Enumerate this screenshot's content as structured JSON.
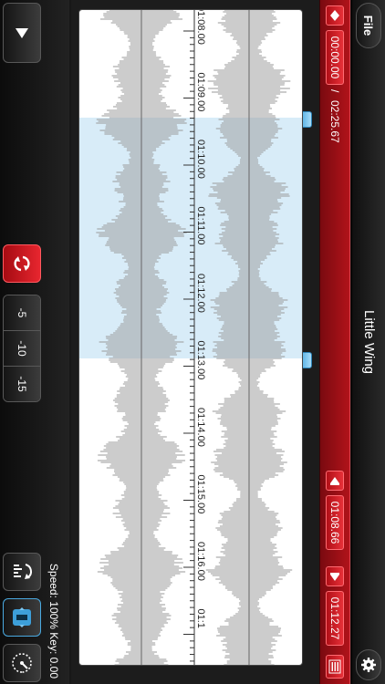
{
  "app": {
    "title": "Little Wing",
    "file_label": "File",
    "settings_icon": "gear-icon"
  },
  "transport": {
    "current_time": "00:00.00",
    "separator": "/",
    "total_time": "02:25.67",
    "loop_start": "01:08.66",
    "loop_end": "01:12.27",
    "icons": [
      "skip-to-start-icon",
      "prev-marker-icon",
      "next-marker-icon",
      "list-icon"
    ]
  },
  "waveform": {
    "time_labels": [
      "01:08.00",
      "01:09.00",
      "01:10.00",
      "01:11.00",
      "01:12.00",
      "01:13.00",
      "01:14.00",
      "01:15.00",
      "01:16.00",
      "01:1"
    ],
    "selection_color": "#a8d4f0",
    "wave_color": "#9a9a9a"
  },
  "controls": {
    "play_icon": "play-icon",
    "loop_icon": "loop-icon",
    "skip_buttons": [
      "-5",
      "-10",
      "-15"
    ],
    "speed_key": "Speed: 100% Key: 0.00",
    "mode_icons": [
      "pitch-speed-icon",
      "section-icon",
      "tuner-icon"
    ],
    "loop_active_color": "#d7141d"
  }
}
